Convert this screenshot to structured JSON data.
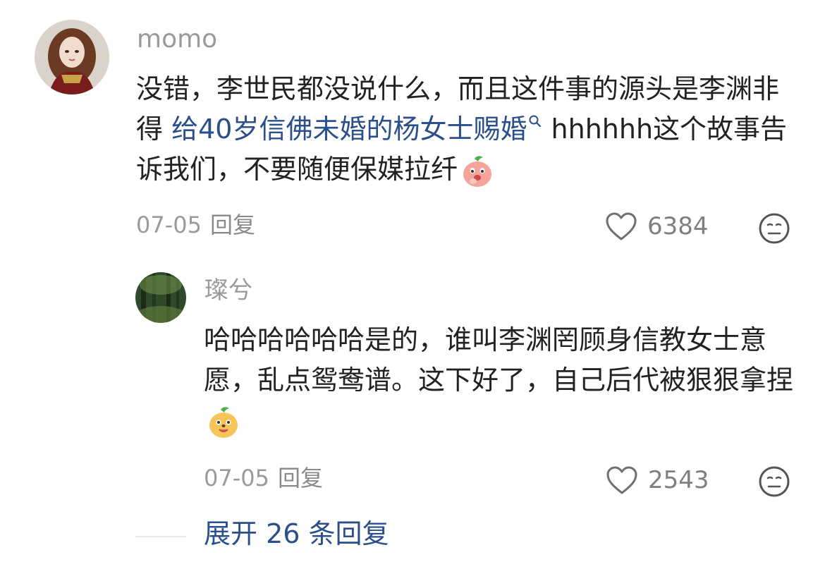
{
  "comment": {
    "username": "momo",
    "text_before": "没错，李世民都没说什么，而且这件事的源头是李渊非得 ",
    "link_text": "给40岁信佛未婚的杨女士赐婚",
    "text_after": " hhhhhh这个故事告诉我们，不要随便保媒拉纤",
    "date": "07-05",
    "reply_label": "回复",
    "likes": "6384"
  },
  "reply": {
    "username": "璨兮",
    "text": "哈哈哈哈哈哈是的，谁叫李渊罔顾身信教女士意愿，乱点鸳鸯谱。这下好了，自己后代被狠狠拿捏",
    "date": "07-05",
    "reply_label": "回复",
    "likes": "2543"
  },
  "expand": {
    "label": "展开 26 条回复"
  },
  "colors": {
    "link": "#2a4f8c",
    "meta": "#9a9a9a"
  },
  "icons": [
    "heart-icon",
    "neutral-face-icon",
    "search-icon",
    "peach-emoji",
    "peach-smile-emoji"
  ]
}
